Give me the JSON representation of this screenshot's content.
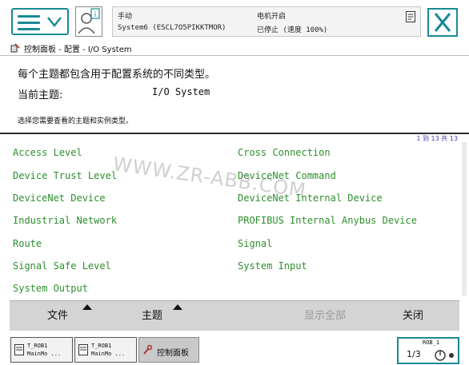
{
  "header": {
    "mode": "手动",
    "system": "System6 (ESCL7O5PIKKTMOR)",
    "motor_state": "电机开启",
    "run_state": "已停止 (速度 100%)"
  },
  "breadcrumb": "控制面板 - 配置 - I/O System",
  "content": {
    "description": "每个主题都包含用于配置系统的不同类型。",
    "current_topic_label": "当前主题:",
    "current_topic_value": "I/O System",
    "instruction": "选择您需要查看的主题和实例类型。"
  },
  "pager": "1 到 13 共 13",
  "types_left": [
    "Access Level",
    "Device Trust Level",
    "DeviceNet Device",
    "Industrial Network",
    "Route",
    "Signal Safe Level",
    "System Output"
  ],
  "types_right": [
    "Cross Connection",
    "DeviceNet Command",
    "DeviceNet Internal Device",
    "PROFIBUS Internal Anybus Device",
    "Signal",
    "System Input"
  ],
  "watermark": "WWW.ZR-ABB.COM",
  "bottom_bar": {
    "file": "文件",
    "topics": "主题",
    "show_all": "显示全部",
    "close": "关闭"
  },
  "taskbar": {
    "task1_line1": "T_ROB1",
    "task1_line2": "MainMo ...",
    "task2_line1": "T_ROB1",
    "task2_line2": "MainMo ...",
    "task3": "控制面板",
    "quickset_label": "ROB_1",
    "quickset_value": "1/3"
  },
  "colors": {
    "accent": "#1a8a94",
    "link": "#2e8f2e",
    "pager": "#4a3fb5"
  }
}
